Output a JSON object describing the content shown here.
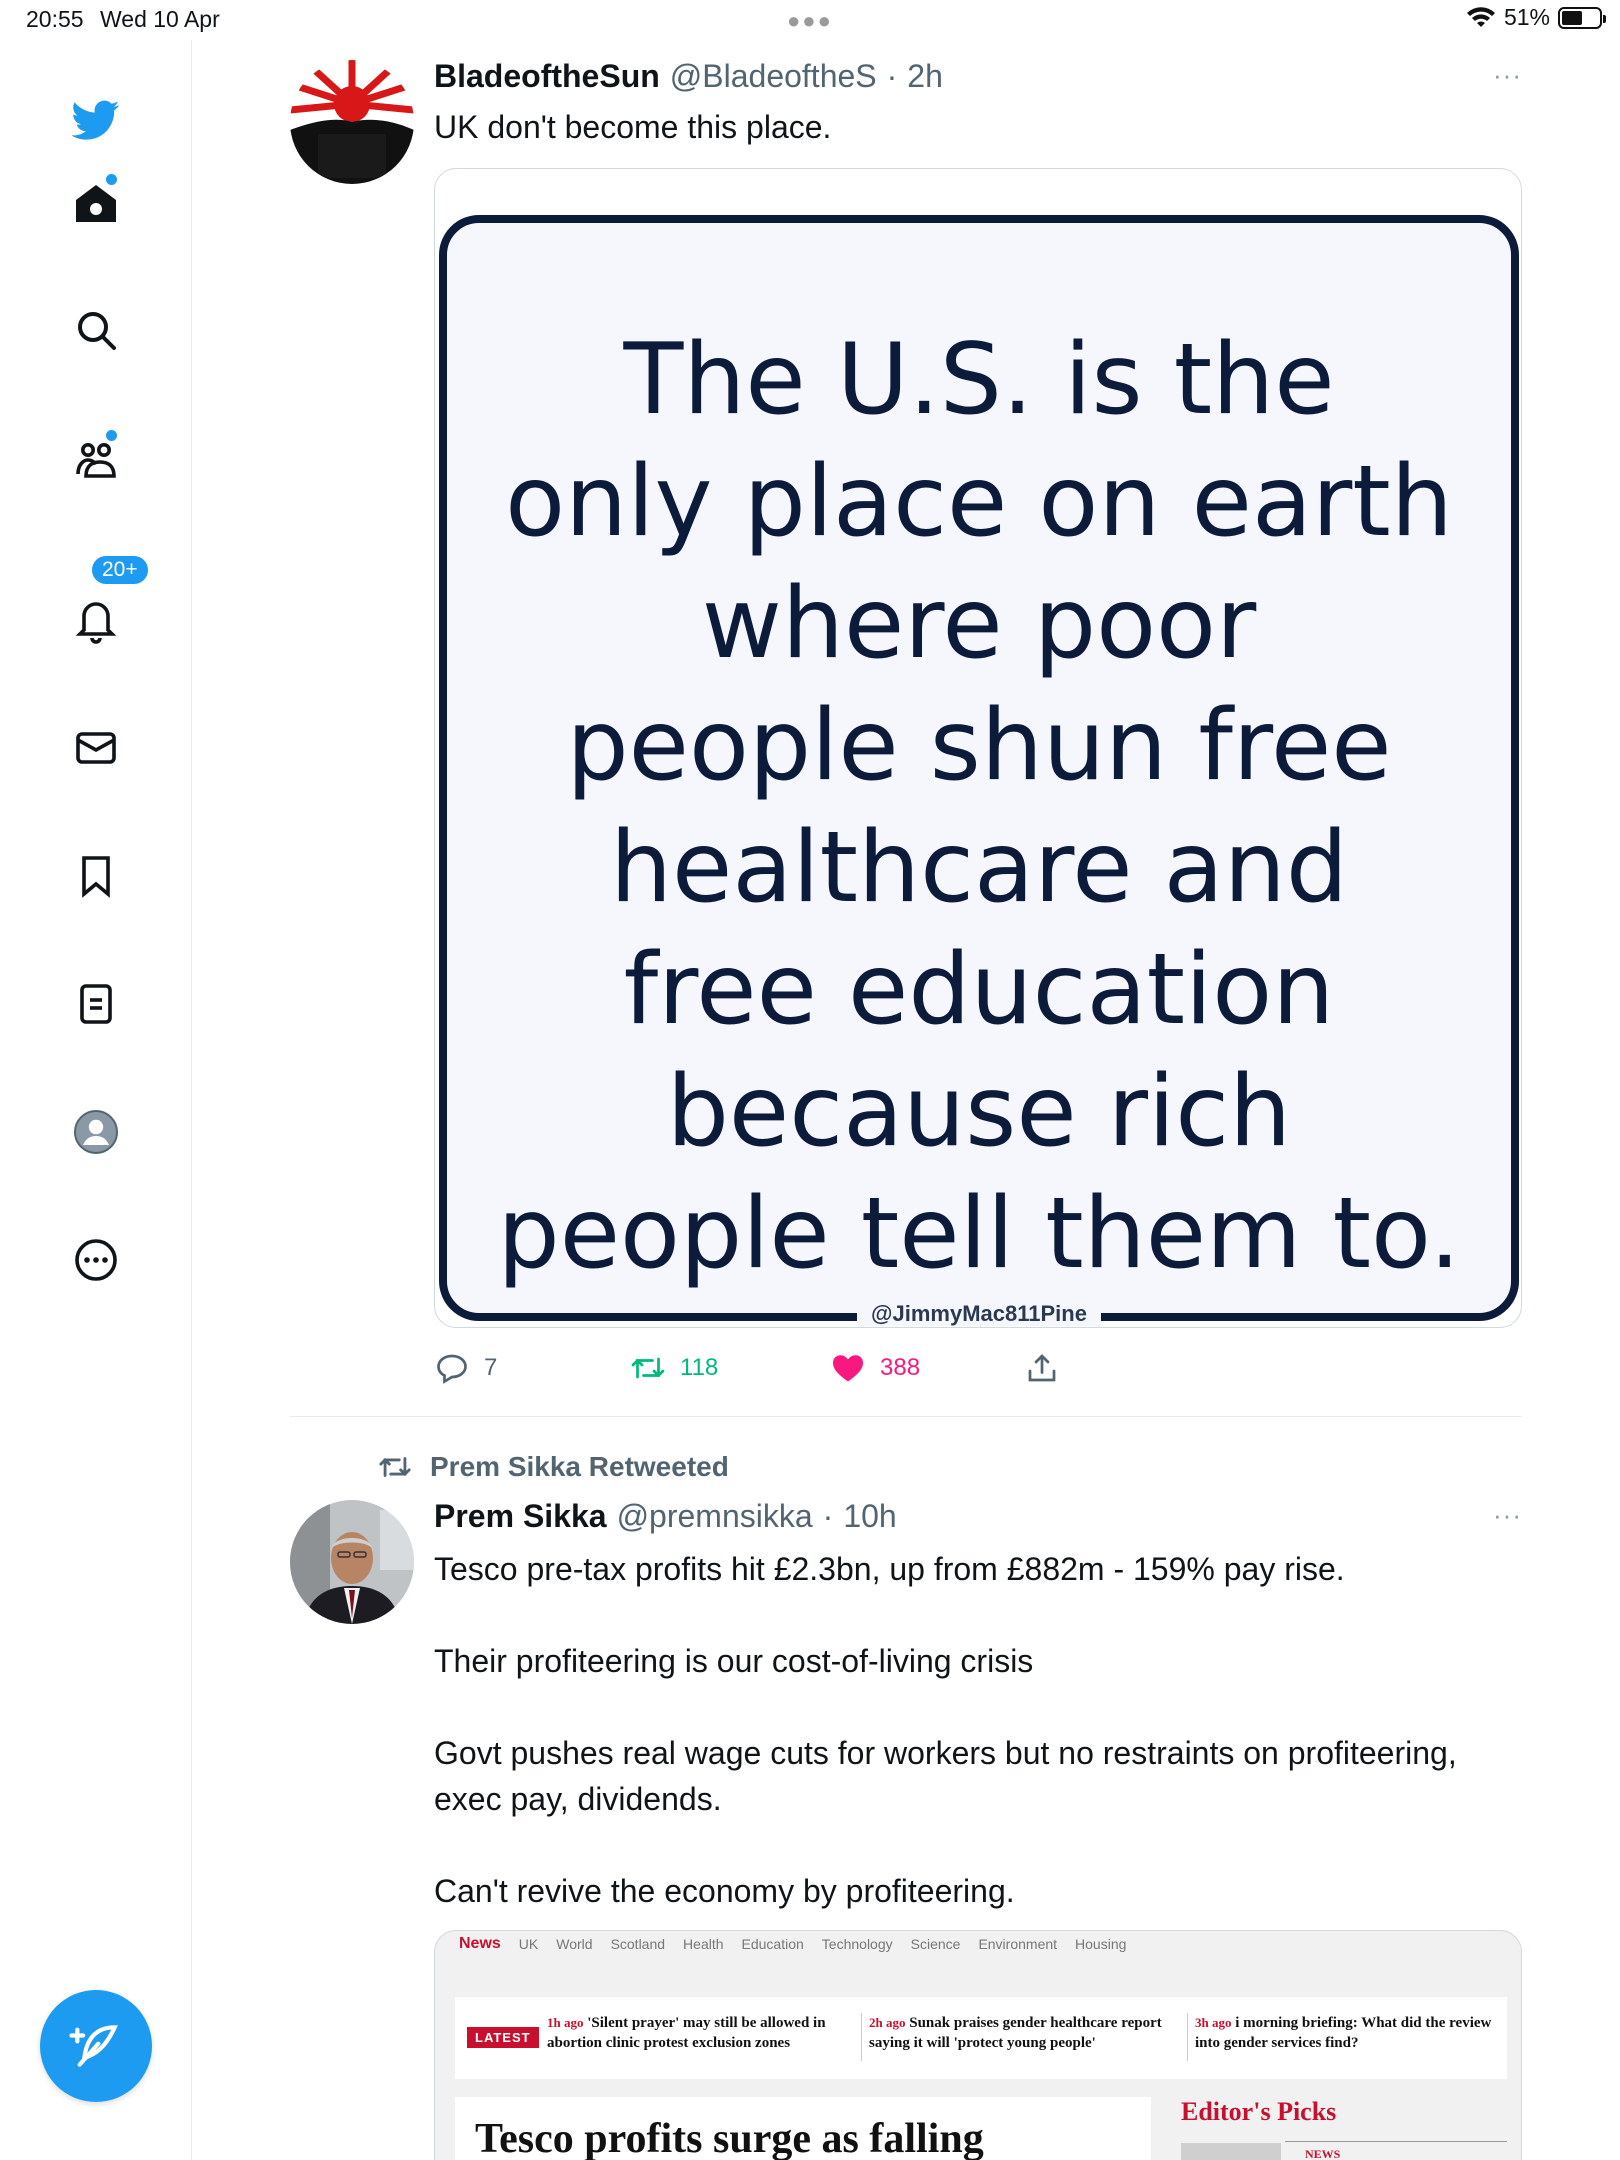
{
  "status_bar": {
    "time": "20:55",
    "date": "Wed 10 Apr",
    "battery": "51%",
    "battery_level": 0.51
  },
  "sidebar": {
    "items": [
      {
        "name": "twitter-logo"
      },
      {
        "name": "home",
        "has_dot": true
      },
      {
        "name": "explore"
      },
      {
        "name": "communities",
        "has_dot": true
      },
      {
        "name": "notifications",
        "badge": "20+"
      },
      {
        "name": "messages"
      },
      {
        "name": "bookmarks"
      },
      {
        "name": "lists"
      },
      {
        "name": "profile"
      },
      {
        "name": "more"
      }
    ],
    "notification_badge": "20+"
  },
  "tweets": [
    {
      "name": "BladeoftheSun",
      "handle": "@BladeoftheS",
      "separator": "·",
      "time": "2h",
      "text": "UK don't become this place.",
      "more": "···",
      "image": {
        "lines": [
          "The U.S. is the",
          "only place on earth",
          "where poor",
          "people shun free",
          "healthcare and",
          "free education",
          "because rich",
          "people tell them to."
        ],
        "credit": "@JimmyMac811Pine"
      },
      "avatar_text": "BLADE OF THE SUN",
      "actions": {
        "replies": "7",
        "retweets": "118",
        "likes": "388"
      }
    },
    {
      "retweeted_by": "Prem Sikka Retweeted",
      "name": "Prem Sikka",
      "handle": "@premnsikka",
      "separator": "·",
      "time": "10h",
      "more": "···",
      "text_lines": [
        "Tesco pre-tax profits hit £2.3bn, up from £882m - 159% pay rise.",
        "Their profiteering is our cost-of-living crisis",
        "Govt pushes real wage cuts for workers but no restraints on profiteering, exec pay, dividends.",
        "Can't revive the economy by profiteering."
      ],
      "news_card": {
        "nav": [
          "News",
          "UK",
          "World",
          "Scotland",
          "Health",
          "Education",
          "Technology",
          "Science",
          "Environment",
          "Housing"
        ],
        "latest_label": "LATEST",
        "latest": [
          {
            "ago": "1h ago",
            "text": "'Silent prayer' may still be allowed in abortion clinic protest exclusion zones"
          },
          {
            "ago": "2h ago",
            "text": "Sunak praises gender healthcare report saying it will 'protect young people'"
          },
          {
            "ago": "3h ago",
            "text": "i morning briefing: What did the review into gender services find?"
          }
        ],
        "headline": "Tesco profits surge as falling",
        "editors_picks": "Editor's Picks",
        "editors_tag": "NEWS"
      }
    }
  ],
  "colors": {
    "twitter_blue": "#1d9bf0",
    "like_pink": "#f91880",
    "retweet_green": "#00ba7c",
    "text_secondary": "#536471",
    "news_red": "#c8102e",
    "sign_navy": "#0c1b3a"
  }
}
